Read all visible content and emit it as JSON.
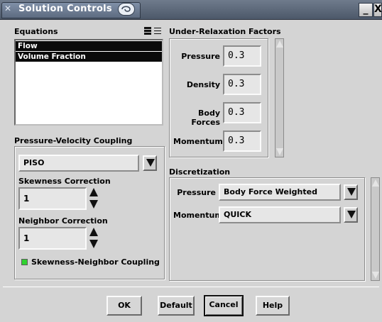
{
  "window": {
    "title": "Solution Controls",
    "icons": [
      "app-icon",
      "swirl-icon",
      "minimize-icon",
      "close-icon"
    ],
    "minimize_glyph": "_",
    "close_glyph": "X"
  },
  "equations": {
    "label": "Equations",
    "items": [
      {
        "label": "Flow",
        "selected": true
      },
      {
        "label": "Volume Fraction",
        "selected": true
      }
    ]
  },
  "pressure_velocity_coupling": {
    "label": "Pressure-Velocity Coupling",
    "scheme": "PISO",
    "skewness_correction": {
      "label": "Skewness Correction",
      "value": "1"
    },
    "neighbor_correction": {
      "label": "Neighbor Correction",
      "value": "1"
    },
    "skewness_neighbor_coupling": {
      "label": "Skewness-Neighbor Coupling",
      "checked": true
    }
  },
  "under_relaxation": {
    "label": "Under-Relaxation Factors",
    "factors": [
      {
        "label": "Pressure",
        "value": "0.3"
      },
      {
        "label": "Density",
        "value": "0.3"
      },
      {
        "label": "Body Forces",
        "value": "0.3"
      },
      {
        "label": "Momentum",
        "value": "0.3"
      }
    ]
  },
  "discretization": {
    "label": "Discretization",
    "rows": [
      {
        "label": "Pressure",
        "value": "Body Force Weighted"
      },
      {
        "label": "Momentum",
        "value": "QUICK"
      }
    ]
  },
  "buttons": {
    "ok": "OK",
    "default": "Default",
    "cancel": "Cancel",
    "help": "Help"
  },
  "colors": {
    "titlebar": "#5d6b80",
    "checkbox_on": "#2fd12f",
    "panel": "#d4d4d4"
  }
}
